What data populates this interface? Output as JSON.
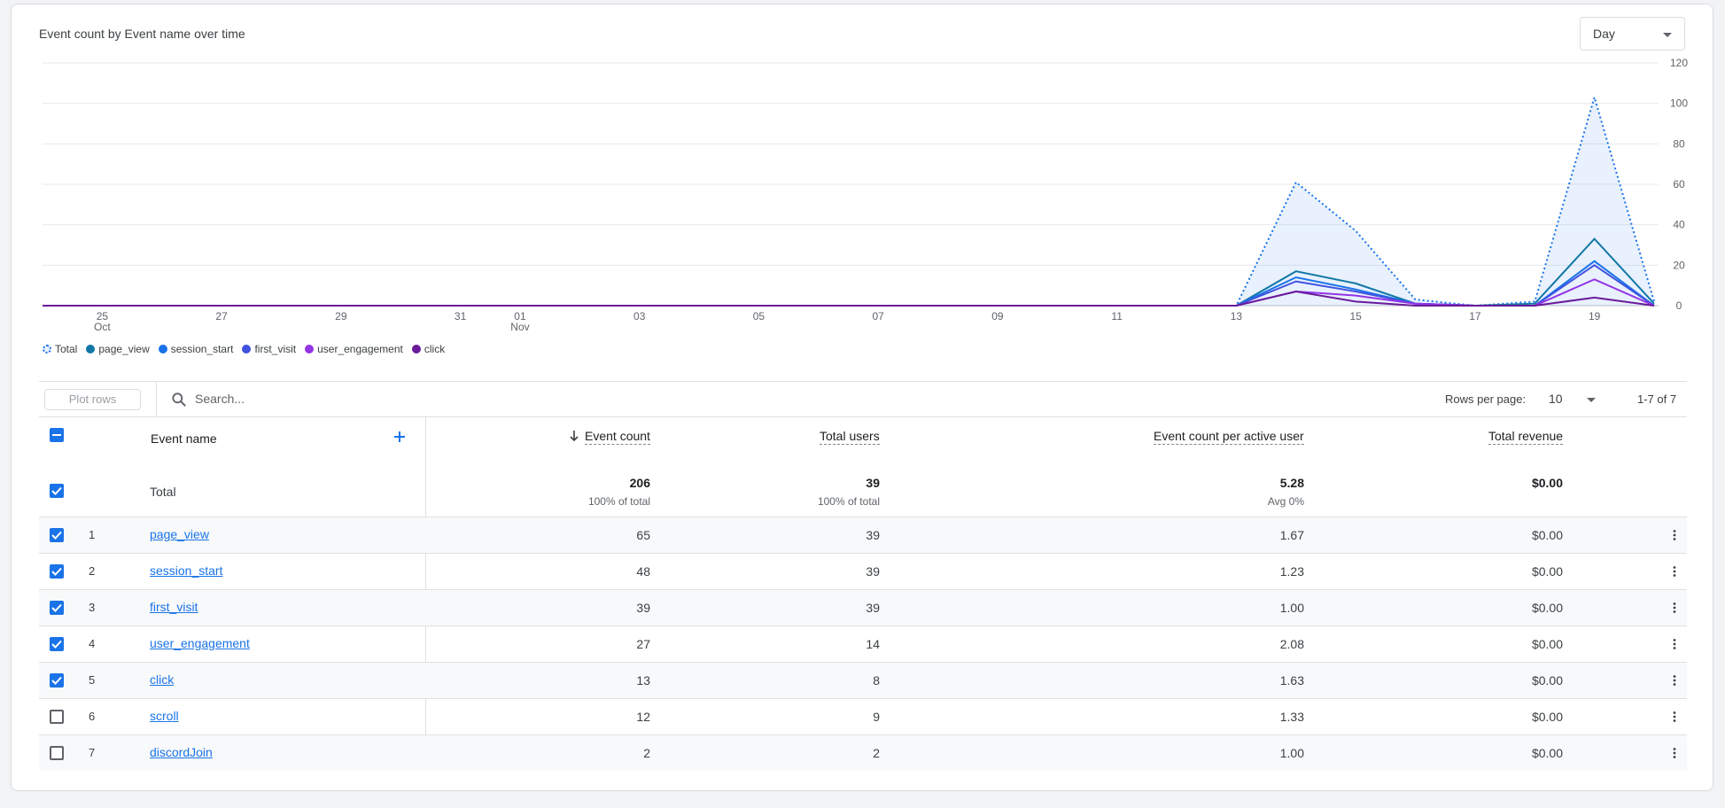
{
  "card": {
    "title": "Event count by Event name over time",
    "granularity": "Day"
  },
  "chart_data": {
    "type": "line",
    "title": "Event count by Event name over time",
    "xlabel": "",
    "ylabel": "",
    "x": [
      "Oct 24",
      "Oct 25",
      "Oct 26",
      "Oct 27",
      "Oct 28",
      "Oct 29",
      "Oct 30",
      "Oct 31",
      "Nov 01",
      "Nov 02",
      "Nov 03",
      "Nov 04",
      "Nov 05",
      "Nov 06",
      "Nov 07",
      "Nov 08",
      "Nov 09",
      "Nov 10",
      "Nov 11",
      "Nov 12",
      "Nov 13",
      "Nov 14",
      "Nov 15",
      "Nov 16",
      "Nov 17",
      "Nov 18",
      "Nov 19",
      "Nov 20"
    ],
    "x_tick_labels": [
      {
        "day": "25",
        "month": "Oct",
        "index": 1
      },
      {
        "day": "27",
        "month": "",
        "index": 3
      },
      {
        "day": "29",
        "month": "",
        "index": 5
      },
      {
        "day": "31",
        "month": "",
        "index": 7
      },
      {
        "day": "01",
        "month": "Nov",
        "index": 8
      },
      {
        "day": "03",
        "month": "",
        "index": 10
      },
      {
        "day": "05",
        "month": "",
        "index": 12
      },
      {
        "day": "07",
        "month": "",
        "index": 14
      },
      {
        "day": "09",
        "month": "",
        "index": 16
      },
      {
        "day": "11",
        "month": "",
        "index": 18
      },
      {
        "day": "13",
        "month": "",
        "index": 20
      },
      {
        "day": "15",
        "month": "",
        "index": 22
      },
      {
        "day": "17",
        "month": "",
        "index": 24
      },
      {
        "day": "19",
        "month": "",
        "index": 26
      }
    ],
    "y_ticks": [
      0,
      20,
      40,
      60,
      80,
      100,
      120
    ],
    "ylim": [
      0,
      120
    ],
    "y_axis_side": "right",
    "grid": true,
    "legend_position": "bottom-left",
    "series": [
      {
        "name": "Total",
        "style": "dotted-area",
        "color": "#1a73e8",
        "values": [
          0,
          0,
          0,
          0,
          0,
          0,
          0,
          0,
          0,
          0,
          0,
          0,
          0,
          0,
          0,
          0,
          0,
          0,
          0,
          0,
          0,
          61,
          37,
          3,
          0,
          2,
          103,
          2
        ]
      },
      {
        "name": "page_view",
        "color": "#1177a6",
        "values": [
          0,
          0,
          0,
          0,
          0,
          0,
          0,
          0,
          0,
          0,
          0,
          0,
          0,
          0,
          0,
          0,
          0,
          0,
          0,
          0,
          0,
          17,
          11,
          1,
          0,
          1,
          33,
          1
        ]
      },
      {
        "name": "session_start",
        "color": "#1a73e8",
        "values": [
          0,
          0,
          0,
          0,
          0,
          0,
          0,
          0,
          0,
          0,
          0,
          0,
          0,
          0,
          0,
          0,
          0,
          0,
          0,
          0,
          0,
          14,
          8,
          1,
          0,
          0,
          22,
          0
        ]
      },
      {
        "name": "first_visit",
        "color": "#4052e0",
        "values": [
          0,
          0,
          0,
          0,
          0,
          0,
          0,
          0,
          0,
          0,
          0,
          0,
          0,
          0,
          0,
          0,
          0,
          0,
          0,
          0,
          0,
          12,
          7,
          1,
          0,
          0,
          20,
          0
        ]
      },
      {
        "name": "user_engagement",
        "color": "#9334e6",
        "values": [
          0,
          0,
          0,
          0,
          0,
          0,
          0,
          0,
          0,
          0,
          0,
          0,
          0,
          0,
          0,
          0,
          0,
          0,
          0,
          0,
          0,
          7,
          5,
          1,
          0,
          0,
          13,
          0
        ]
      },
      {
        "name": "click",
        "color": "#6a1b9a",
        "values": [
          0,
          0,
          0,
          0,
          0,
          0,
          0,
          0,
          0,
          0,
          0,
          0,
          0,
          0,
          0,
          0,
          0,
          0,
          0,
          0,
          0,
          7,
          2,
          0,
          0,
          0,
          4,
          0
        ]
      }
    ]
  },
  "toolbar": {
    "plot_rows_label": "Plot rows",
    "search_placeholder": "Search...",
    "rows_per_page_label": "Rows per page:",
    "rows_per_page_value": "10",
    "page_range": "1-7 of 7"
  },
  "table": {
    "headers": {
      "event_name": "Event name",
      "event_count": "Event count",
      "total_users": "Total users",
      "per_user": "Event count per active user",
      "revenue": "Total revenue"
    },
    "totals": {
      "label": "Total",
      "event_count": "206",
      "event_count_sub": "100% of total",
      "total_users": "39",
      "total_users_sub": "100% of total",
      "per_user": "5.28",
      "per_user_sub": "Avg 0%",
      "revenue": "$0.00"
    },
    "rows": [
      {
        "index": "1",
        "name": "page_view",
        "event_count": "65",
        "total_users": "39",
        "per_user": "1.67",
        "revenue": "$0.00",
        "checked": true
      },
      {
        "index": "2",
        "name": "session_start",
        "event_count": "48",
        "total_users": "39",
        "per_user": "1.23",
        "revenue": "$0.00",
        "checked": true
      },
      {
        "index": "3",
        "name": "first_visit",
        "event_count": "39",
        "total_users": "39",
        "per_user": "1.00",
        "revenue": "$0.00",
        "checked": true
      },
      {
        "index": "4",
        "name": "user_engagement",
        "event_count": "27",
        "total_users": "14",
        "per_user": "2.08",
        "revenue": "$0.00",
        "checked": true
      },
      {
        "index": "5",
        "name": "click",
        "event_count": "13",
        "total_users": "8",
        "per_user": "1.63",
        "revenue": "$0.00",
        "checked": true
      },
      {
        "index": "6",
        "name": "scroll",
        "event_count": "12",
        "total_users": "9",
        "per_user": "1.33",
        "revenue": "$0.00",
        "checked": false
      },
      {
        "index": "7",
        "name": "discordJoin",
        "event_count": "2",
        "total_users": "2",
        "per_user": "1.00",
        "revenue": "$0.00",
        "checked": false
      }
    ]
  }
}
